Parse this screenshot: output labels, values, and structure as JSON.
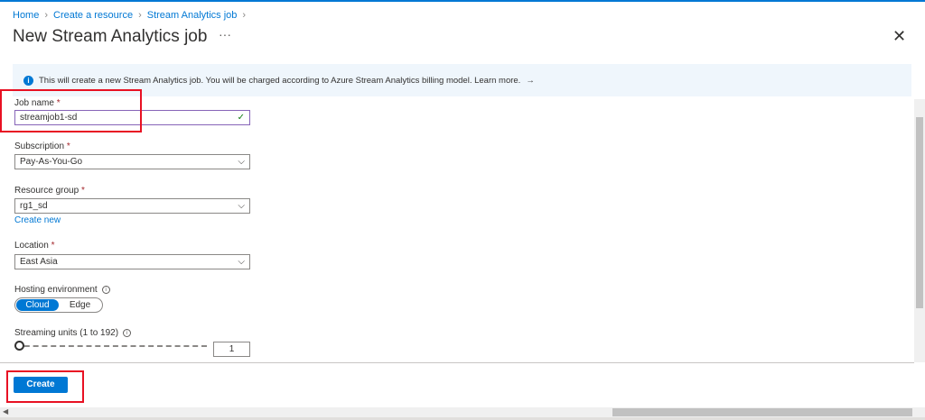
{
  "breadcrumb": [
    "Home",
    "Create a resource",
    "Stream Analytics job"
  ],
  "title": "New Stream Analytics job",
  "more": "···",
  "close": "✕",
  "banner": {
    "text": "This will create a new Stream Analytics job. You will be charged according to Azure Stream Analytics billing model. Learn more.",
    "arrow": "→"
  },
  "job_name": {
    "label": "Job name",
    "required": "*",
    "value": "streamjob1-sd",
    "check": "✓"
  },
  "subscription": {
    "label": "Subscription",
    "required": "*",
    "value": "Pay-As-You-Go"
  },
  "resource_group": {
    "label": "Resource group",
    "required": "*",
    "value": "rg1_sd",
    "create_new": "Create new"
  },
  "location": {
    "label": "Location",
    "required": "*",
    "value": "East Asia"
  },
  "hosting": {
    "label": "Hosting environment",
    "options": [
      "Cloud",
      "Edge"
    ],
    "selected": "Cloud"
  },
  "streaming_units": {
    "label": "Streaming units (1 to 192)",
    "value": "1"
  },
  "create_label": "Create",
  "colors": {
    "accent": "#0078d4",
    "highlight": "#e81123"
  }
}
